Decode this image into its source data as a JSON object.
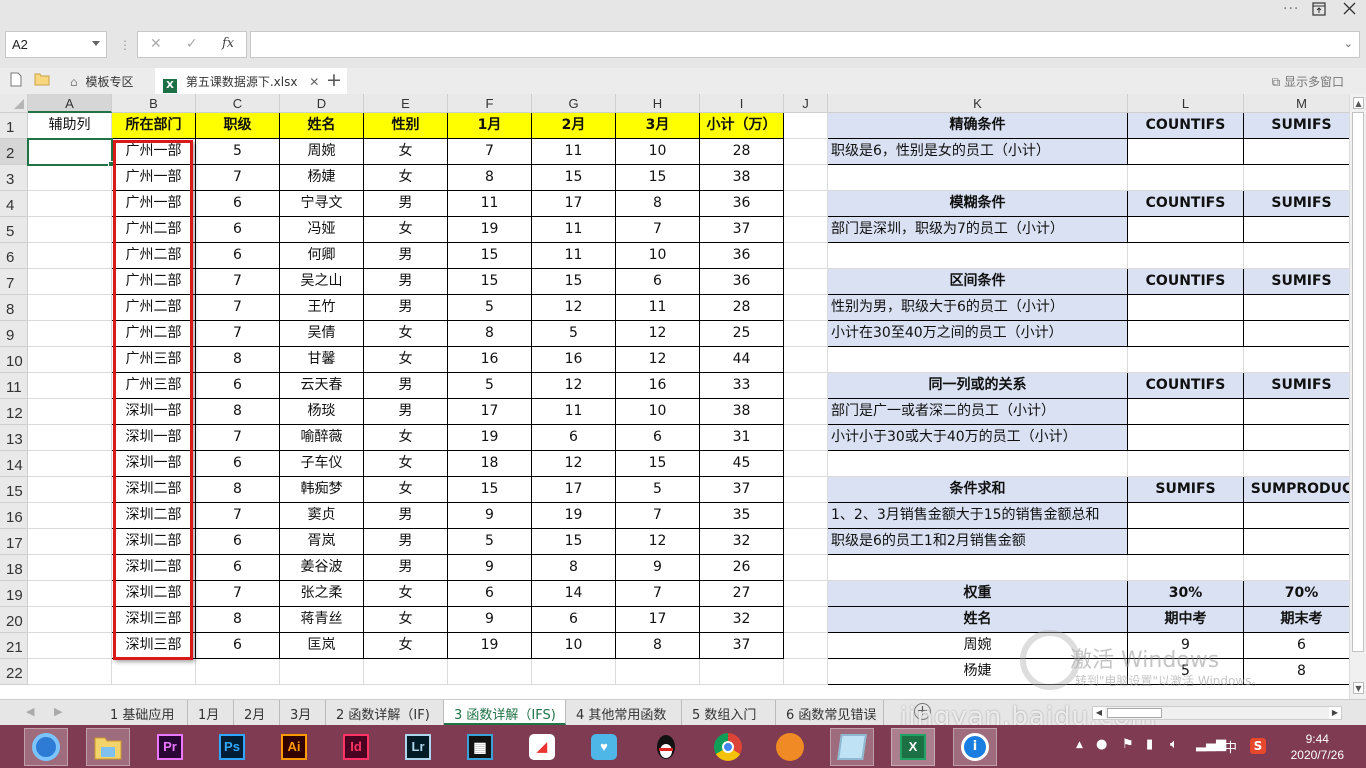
{
  "window": {
    "more_icon": "more-icon",
    "restore_icon": "restore-icon",
    "close_icon": "close-icon"
  },
  "formula_bar": {
    "name_box": "A2",
    "cancel_glyph": "✕",
    "confirm_glyph": "✓",
    "fx_glyph": "fx",
    "formula_value": ""
  },
  "doc_tabs": {
    "template_tab": "模板专区",
    "file_tab": "第五课数据源下.xlsx",
    "xl_badge": "X",
    "multi_window": "显示多窗口"
  },
  "columns": [
    "A",
    "B",
    "C",
    "D",
    "E",
    "F",
    "G",
    "H",
    "I",
    "J",
    "K",
    "L",
    "M"
  ],
  "rows": [
    "1",
    "2",
    "3",
    "4",
    "5",
    "6",
    "7",
    "8",
    "9",
    "10",
    "11",
    "12",
    "13",
    "14",
    "15",
    "16",
    "17",
    "18",
    "19",
    "20",
    "21",
    "22"
  ],
  "main_table": {
    "helper_header": "辅助列",
    "headers": [
      "所在部门",
      "职级",
      "姓名",
      "性别",
      "1月",
      "2月",
      "3月",
      "小计（万）"
    ],
    "rows": [
      [
        "广州一部",
        "5",
        "周婉",
        "女",
        "7",
        "11",
        "10",
        "28"
      ],
      [
        "广州一部",
        "7",
        "杨婕",
        "女",
        "8",
        "15",
        "15",
        "38"
      ],
      [
        "广州一部",
        "6",
        "宁寻文",
        "男",
        "11",
        "17",
        "8",
        "36"
      ],
      [
        "广州二部",
        "6",
        "冯娅",
        "女",
        "19",
        "11",
        "7",
        "37"
      ],
      [
        "广州二部",
        "6",
        "何卿",
        "男",
        "15",
        "11",
        "10",
        "36"
      ],
      [
        "广州二部",
        "7",
        "吴之山",
        "男",
        "15",
        "15",
        "6",
        "36"
      ],
      [
        "广州二部",
        "7",
        "王竹",
        "男",
        "5",
        "12",
        "11",
        "28"
      ],
      [
        "广州二部",
        "7",
        "吴倩",
        "女",
        "8",
        "5",
        "12",
        "25"
      ],
      [
        "广州三部",
        "8",
        "甘馨",
        "女",
        "16",
        "16",
        "12",
        "44"
      ],
      [
        "广州三部",
        "6",
        "云天春",
        "男",
        "5",
        "12",
        "16",
        "33"
      ],
      [
        "深圳一部",
        "8",
        "杨琰",
        "男",
        "17",
        "11",
        "10",
        "38"
      ],
      [
        "深圳一部",
        "7",
        "喻醉薇",
        "女",
        "19",
        "6",
        "6",
        "31"
      ],
      [
        "深圳一部",
        "6",
        "子车仪",
        "女",
        "18",
        "12",
        "15",
        "45"
      ],
      [
        "深圳二部",
        "8",
        "韩痴梦",
        "女",
        "15",
        "17",
        "5",
        "37"
      ],
      [
        "深圳二部",
        "7",
        "窦贞",
        "男",
        "9",
        "19",
        "7",
        "35"
      ],
      [
        "深圳二部",
        "6",
        "胥岚",
        "男",
        "5",
        "15",
        "12",
        "32"
      ],
      [
        "深圳二部",
        "6",
        "姜谷波",
        "男",
        "9",
        "8",
        "9",
        "26"
      ],
      [
        "深圳二部",
        "7",
        "张之柔",
        "女",
        "6",
        "14",
        "7",
        "27"
      ],
      [
        "深圳三部",
        "8",
        "蒋青丝",
        "女",
        "9",
        "6",
        "17",
        "32"
      ],
      [
        "深圳三部",
        "6",
        "匡岚",
        "女",
        "19",
        "10",
        "8",
        "37"
      ]
    ]
  },
  "right_tables": {
    "exact": {
      "title": "精确条件",
      "col1": "COUNTIFS",
      "col2": "SUMIFS",
      "rows": [
        "职级是6，性别是女的员工（小计）"
      ]
    },
    "fuzzy": {
      "title": "模糊条件",
      "col1": "COUNTIFS",
      "col2": "SUMIFS",
      "rows": [
        "部门是深圳，职级为7的员工（小计）"
      ]
    },
    "range": {
      "title": "区间条件",
      "col1": "COUNTIFS",
      "col2": "SUMIFS",
      "rows": [
        "性别为男，职级大于6的员工（小计）",
        "小计在30至40万之间的员工（小计）"
      ]
    },
    "or_relation": {
      "title": "同一列或的关系",
      "col1": "COUNTIFS",
      "col2": "SUMIFS",
      "rows": [
        "部门是广一或者深二的员工（小计）",
        "小计小于30或大于40万的员工（小计）"
      ]
    },
    "cond_sum": {
      "title": "条件求和",
      "col1": "SUMIFS",
      "col2": "SUMPRODUC",
      "rows": [
        "1、2、3月销售金额大于15的销售金额总和",
        "职级是6的员工1和2月销售金额"
      ]
    },
    "weight": {
      "title": "权重",
      "w1": "30%",
      "w2": "70%",
      "name_header": "姓名",
      "mid_header": "期中考",
      "final_header": "期末考",
      "rows": [
        {
          "name": "周婉",
          "mid": "9",
          "final": "6"
        },
        {
          "name": "杨婕",
          "mid": "5",
          "final": "8"
        }
      ]
    }
  },
  "sheet_tabs": [
    "1 基础应用",
    "1月",
    "2月",
    "3月",
    "2 函数详解（IF)",
    "3 函数详解（IFS)",
    "4 其他常用函数",
    "5 数组入门",
    "6 函数常见错误"
  ],
  "active_sheet": "3 函数详解（IFS)",
  "watermark": {
    "activate": "激活 Windows",
    "activate_sub": "转到\"电脑设置\"以激活 Windows。",
    "site": "jingyan.baidu.com"
  },
  "taskbar": {
    "apps": [
      {
        "name": "browser-app",
        "label": ""
      },
      {
        "name": "file-explorer-app",
        "label": ""
      },
      {
        "name": "premiere-app",
        "label": "Pr",
        "color": "#ea77ff",
        "bg": "#2a0634"
      },
      {
        "name": "photoshop-app",
        "label": "Ps",
        "color": "#31a8ff",
        "bg": "#001e36"
      },
      {
        "name": "illustrator-app",
        "label": "Ai",
        "color": "#ff9a00",
        "bg": "#330000"
      },
      {
        "name": "indesign-app",
        "label": "Id",
        "color": "#ff3366",
        "bg": "#49021f"
      },
      {
        "name": "lightroom-app",
        "label": "Lr",
        "color": "#add5ec",
        "bg": "#001a26"
      }
    ],
    "ime": "中",
    "time": "9:44",
    "date": "2020/7/26"
  },
  "colors": {
    "header_yellow": "#ffff00",
    "table_blue": "#d9e1f2",
    "excel_green": "#217346",
    "highlight_red": "#d9191a",
    "taskbar": "#7e3b52"
  }
}
